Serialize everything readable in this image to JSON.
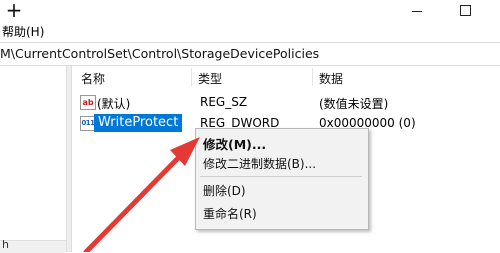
{
  "titlebar": {
    "new_symbol": "+",
    "minimize_label": "—",
    "maximize_label": "☐"
  },
  "menu": {
    "help": "帮助(H)"
  },
  "address": {
    "path": "M\\CurrentControlSet\\Control\\StorageDevicePolicies"
  },
  "tree": {
    "partial_label": "h"
  },
  "columns": {
    "name": "名称",
    "type": "类型",
    "data": "数据"
  },
  "rows": [
    {
      "name": "(默认)",
      "type": "REG_SZ",
      "data": "(数值未设置)",
      "icon": "string-value-icon"
    },
    {
      "name": "WriteProtect",
      "type": "REG_DWORD",
      "data": "0x00000000 (0)",
      "icon": "dword-value-icon"
    }
  ],
  "context_menu": {
    "modify": "修改(M)...",
    "modify_binary": "修改二进制数据(B)...",
    "delete": "删除(D)",
    "rename": "重命名(R)"
  },
  "annotation": {
    "arrow_color": "#e53935"
  },
  "colors": {
    "selection": "#0078d7",
    "menu_background": "#f2f2f2"
  }
}
